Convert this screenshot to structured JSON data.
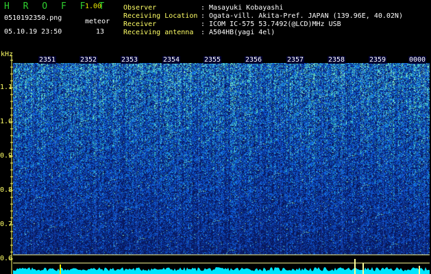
{
  "app": {
    "name": "H R O F F T",
    "version": "1.00"
  },
  "file": {
    "name": "0510192350.png",
    "datetime": "05.10.19 23:50"
  },
  "meteor": {
    "label": "meteor",
    "count": "13"
  },
  "info": [
    {
      "key": "Observer",
      "sep": ":",
      "value": "Masayuki Kobayashi"
    },
    {
      "key": "Receiving Location",
      "sep": ":",
      "value": "Ogata-vill. Akita-Pref. JAPAN (139.96E, 40.02N)"
    },
    {
      "key": "Receiver",
      "sep": ":",
      "value": "ICOM IC-575 53.7492(@LCD)MHz USB"
    },
    {
      "key": "Receiving antenna",
      "sep": ":",
      "value": "A504HB(yagi 4el)"
    }
  ],
  "axis": {
    "unit": "kHz",
    "yticks": [
      "1.1",
      "1.0",
      "0.9",
      "0.8",
      "0.7",
      "0.6"
    ],
    "time_labels": [
      "2351",
      "2352",
      "2353",
      "2354",
      "2355",
      "2356",
      "2357",
      "2358",
      "2359",
      "0000"
    ]
  },
  "colors": {
    "title": "#2fcf2f",
    "accent": "#ffff66",
    "signal_low": "#0a1560",
    "signal_high": "#33ffcc",
    "baseline": "#00ffff"
  }
}
